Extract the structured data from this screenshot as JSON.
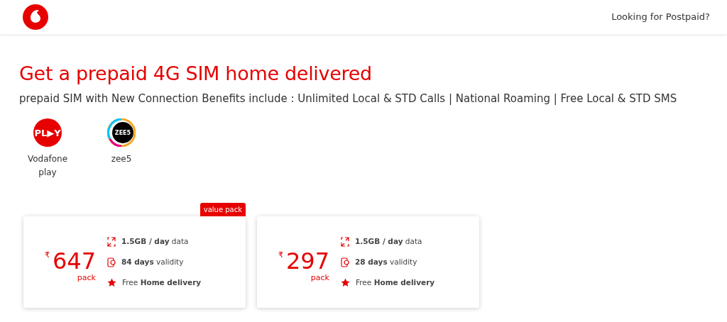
{
  "header": {
    "link": "Looking for Postpaid?"
  },
  "title": "Get a prepaid 4G SIM home delivered",
  "subtitle": "prepaid SIM with New Connection Benefits include : Unlimited Local & STD Calls | National Roaming | Free Local & STD SMS",
  "apps": [
    {
      "kind": "play",
      "logo_text": "PL▶Y",
      "label": "Vodafone play"
    },
    {
      "kind": "zee",
      "logo_text": "ZEE5",
      "label": "zee5"
    }
  ],
  "packs": [
    {
      "currency": "₹",
      "price": "647",
      "unit": "pack",
      "badge": "value pack",
      "features": [
        {
          "kind": "data",
          "text": "**1.5GB / day** data"
        },
        {
          "kind": "validity",
          "text": "**84 days** validity"
        },
        {
          "kind": "delivery",
          "text": "Free **Home delivery**"
        }
      ]
    },
    {
      "currency": "₹",
      "price": "297",
      "unit": "pack",
      "features": [
        {
          "kind": "data",
          "text": "**1.5GB / day** data"
        },
        {
          "kind": "validity",
          "text": "**28 days** validity"
        },
        {
          "kind": "delivery",
          "text": "Free **Home delivery**"
        }
      ]
    }
  ]
}
